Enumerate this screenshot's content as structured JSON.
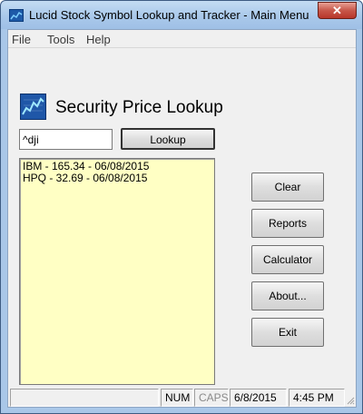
{
  "window": {
    "title": "Lucid Stock Symbol Lookup and Tracker - Main Menu",
    "close_glyph": "✕"
  },
  "menu": [
    "File",
    "Tools",
    "Help"
  ],
  "heading": "Security Price Lookup",
  "symbol_input": {
    "value": "^dji"
  },
  "lookup_button": {
    "label": "Lookup",
    "mnemonic": "L"
  },
  "results": [
    "IBM - 165.34 - 06/08/2015",
    "HPQ - 32.69 - 06/08/2015"
  ],
  "buttons": {
    "clear": "Clear",
    "reports": "Reports",
    "calculator": "Calculator",
    "about": "About...",
    "exit": "Exit"
  },
  "status": {
    "num": "NUM",
    "caps": "CAPS",
    "date": "6/8/2015",
    "time": "4:45 PM"
  },
  "colors": {
    "results_background": "#ffffc4",
    "titlebar": "#a9c8ea",
    "close_button": "#c7574a"
  }
}
